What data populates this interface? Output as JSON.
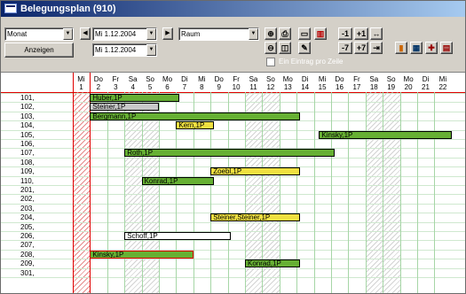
{
  "window": {
    "title": "Belegungsplan  (910)"
  },
  "toolbar": {
    "view_select": "Monat",
    "show_button": "Anzeigen",
    "date_from": "Mi  1.12.2004",
    "date_to": "Mi  1.12.2004",
    "room_select": "Raum",
    "one_entry_per_row_label": "Ein Eintrag pro Zeile",
    "nav_minus1": "-1",
    "nav_plus1": "+1",
    "nav_minus7": "-7",
    "nav_plus7": "+7"
  },
  "calendar": {
    "days": [
      {
        "name": "Mi",
        "num": "1"
      },
      {
        "name": "Do",
        "num": "2"
      },
      {
        "name": "Fr",
        "num": "3"
      },
      {
        "name": "Sa",
        "num": "4"
      },
      {
        "name": "So",
        "num": "5"
      },
      {
        "name": "Mo",
        "num": "6"
      },
      {
        "name": "Di",
        "num": "7"
      },
      {
        "name": "Mi",
        "num": "8"
      },
      {
        "name": "Do",
        "num": "9"
      },
      {
        "name": "Fr",
        "num": "10"
      },
      {
        "name": "Sa",
        "num": "11"
      },
      {
        "name": "So",
        "num": "12"
      },
      {
        "name": "Mo",
        "num": "13"
      },
      {
        "name": "Di",
        "num": "14"
      },
      {
        "name": "Mi",
        "num": "15"
      },
      {
        "name": "Do",
        "num": "16"
      },
      {
        "name": "Fr",
        "num": "17"
      },
      {
        "name": "Sa",
        "num": "18"
      },
      {
        "name": "So",
        "num": "19"
      },
      {
        "name": "Mo",
        "num": "20"
      },
      {
        "name": "Di",
        "num": "21"
      },
      {
        "name": "Mi",
        "num": "22"
      }
    ],
    "rooms": [
      "101,",
      "102,",
      "103,",
      "104,",
      "105,",
      "106,",
      "107,",
      "108,",
      "109,",
      "110,",
      "201,",
      "202,",
      "203,",
      "204,",
      "205,",
      "206,",
      "207,",
      "208,",
      "209,",
      "301,"
    ],
    "bookings": [
      {
        "room": 0,
        "start": 1.0,
        "end": 6.2,
        "label": "Huber,1P",
        "color": "#66b033"
      },
      {
        "room": 1,
        "start": 1.0,
        "end": 5.0,
        "label": "Steiner,1P",
        "color": "#c8c8c8"
      },
      {
        "room": 2,
        "start": 1.0,
        "end": 13.2,
        "label": "Bergmann,1P",
        "color": "#66b033"
      },
      {
        "room": 3,
        "start": 6.0,
        "end": 8.2,
        "label": "Kern,1P",
        "color": "#f0e040"
      },
      {
        "room": 4,
        "start": 14.3,
        "end": 22.0,
        "label": "Kinsky,1P",
        "color": "#66b033"
      },
      {
        "room": 6,
        "start": 3.0,
        "end": 15.2,
        "label": "Roth,1P",
        "color": "#66b033"
      },
      {
        "room": 8,
        "start": 8.0,
        "end": 13.2,
        "label": "Zoebl,1P",
        "color": "#f0e040"
      },
      {
        "room": 9,
        "start": 4.0,
        "end": 8.2,
        "label": "Konrad,1P",
        "color": "#66b033"
      },
      {
        "room": 13,
        "start": 8.0,
        "end": 13.2,
        "label": "Steiner,Steiner,1P",
        "color": "#f0e040"
      },
      {
        "room": 15,
        "start": 3.0,
        "end": 9.2,
        "label": "Schoff,1P",
        "color": "#ffffff"
      },
      {
        "room": 17,
        "start": 1.0,
        "end": 7.0,
        "label": "Kinsky,1P",
        "color": "#66b033",
        "border": "#e00000"
      },
      {
        "room": 18,
        "start": 10.0,
        "end": 13.2,
        "label": "Konrad,1P",
        "color": "#66b033"
      }
    ],
    "colors": {
      "grid_line": "#a6d6a6",
      "today": "#e00000",
      "booked": "#66b033",
      "reserved": "#f0e040",
      "option": "#c8c8c8"
    }
  }
}
